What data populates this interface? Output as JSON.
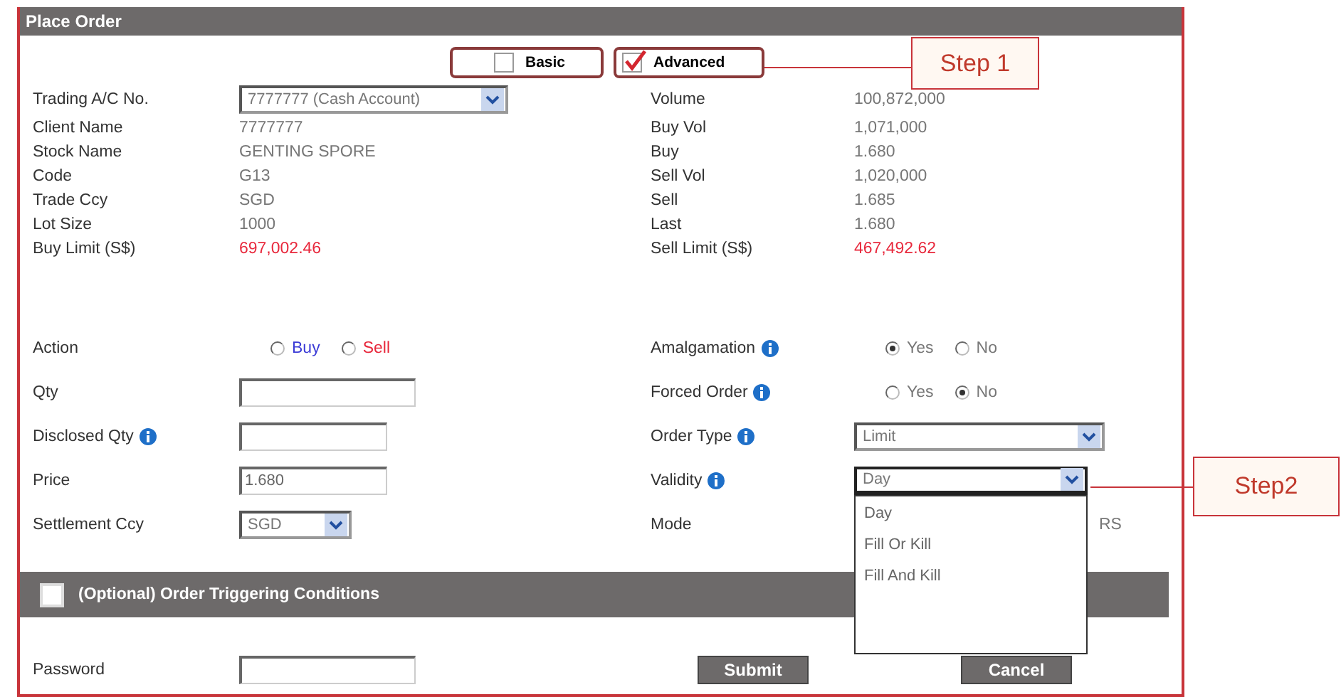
{
  "window": {
    "title": "Place Order"
  },
  "mode_toggle": [
    {
      "label": "Basic",
      "checked": false
    },
    {
      "label": "Advanced",
      "checked": true
    }
  ],
  "stock_info": {
    "left": [
      {
        "label": "Trading A/C No.",
        "value": "7777777 (Cash Account)",
        "kind": "select"
      },
      {
        "label": "Client Name",
        "value": "7777777",
        "kind": "text"
      },
      {
        "label": "Stock Name",
        "value": "GENTING SPORE",
        "kind": "text"
      },
      {
        "label": "Code",
        "value": "G13",
        "kind": "text"
      },
      {
        "label": "Trade Ccy",
        "value": "SGD",
        "kind": "text"
      },
      {
        "label": "Lot Size",
        "value": "1000",
        "kind": "text"
      },
      {
        "label": "Buy Limit (S$)",
        "value": "697,002.46",
        "kind": "limit"
      }
    ],
    "right": [
      {
        "label": "Volume",
        "value": "100,872,000",
        "kind": "text"
      },
      {
        "label": "Buy Vol",
        "value": "1,071,000",
        "kind": "text"
      },
      {
        "label": "Buy",
        "value": "1.680",
        "kind": "text"
      },
      {
        "label": "Sell Vol",
        "value": "1,020,000",
        "kind": "text"
      },
      {
        "label": "Sell",
        "value": "1.685",
        "kind": "text"
      },
      {
        "label": "Last",
        "value": "1.680",
        "kind": "text"
      },
      {
        "label": "Sell Limit (S$)",
        "value": "467,492.62",
        "kind": "limit"
      }
    ]
  },
  "order_fields": {
    "left": [
      {
        "label": "Action",
        "kind": "radio",
        "info": false,
        "options": [
          {
            "label": "Buy",
            "selected": false,
            "color": "#3b3bd6"
          },
          {
            "label": "Sell",
            "selected": false,
            "color": "#e8283c"
          }
        ]
      },
      {
        "label": "Qty",
        "kind": "input",
        "info": false
      },
      {
        "label": "Disclosed Qty",
        "kind": "input",
        "info": true
      },
      {
        "label": "Price",
        "kind": "input",
        "info": false,
        "value": "1.680"
      },
      {
        "label": "Settlement Ccy",
        "kind": "select",
        "info": false,
        "value": "SGD"
      }
    ],
    "right": [
      {
        "label": "Amalgamation",
        "kind": "radio",
        "info": true,
        "options": [
          {
            "label": "Yes",
            "selected": true
          },
          {
            "label": "No",
            "selected": false
          }
        ]
      },
      {
        "label": "Forced Order",
        "kind": "radio",
        "info": true,
        "options": [
          {
            "label": "Yes",
            "selected": false
          },
          {
            "label": "No",
            "selected": true
          }
        ]
      },
      {
        "label": "Order Type",
        "kind": "select",
        "info": true,
        "value": "Limit"
      },
      {
        "label": "Validity",
        "kind": "select",
        "info": true,
        "value": "Day",
        "expanded": true,
        "options": [
          "Day",
          "Fill Or Kill",
          "Fill And Kill"
        ]
      },
      {
        "label": "Mode",
        "kind": "text",
        "info": false,
        "value": "RS"
      }
    ]
  },
  "triggering": {
    "label": "(Optional) Order Triggering Conditions",
    "checked": false
  },
  "password": {
    "label": "Password"
  },
  "buttons": [
    "Submit",
    "Cancel"
  ],
  "callouts": [
    {
      "label": "Step 1"
    },
    {
      "label": "Step2"
    }
  ]
}
